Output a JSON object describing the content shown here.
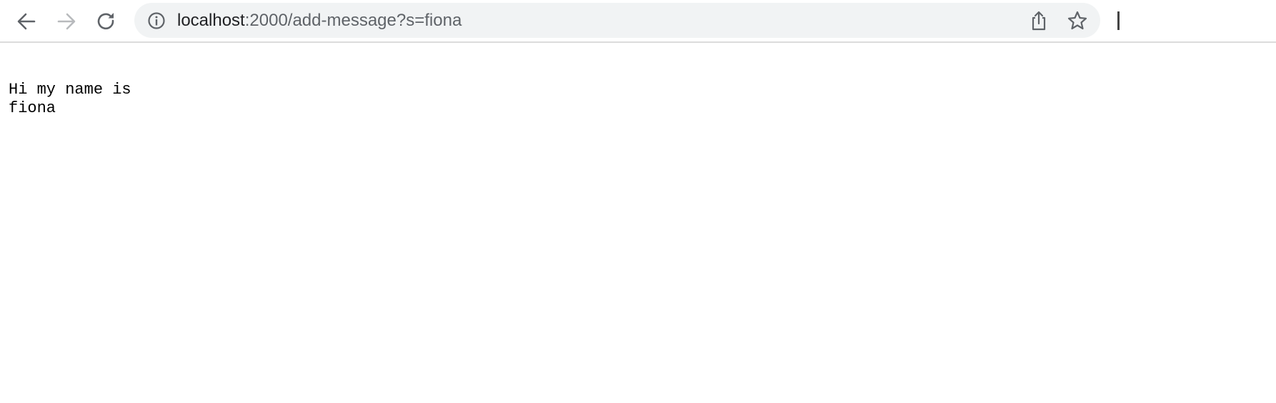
{
  "browser": {
    "url": {
      "host": "localhost",
      "rest": ":2000/add-message?s=fiona"
    },
    "icons": {
      "back": "arrow-left-icon",
      "forward": "arrow-right-icon",
      "reload": "reload-icon",
      "info": "info-icon",
      "share": "share-icon",
      "bookmark": "star-icon"
    },
    "colors": {
      "omnibox_bg": "#f1f3f4",
      "icon_active": "#5f6368",
      "icon_disabled": "#b8babd"
    }
  },
  "page": {
    "lines": [
      "Hi my name is",
      "fiona"
    ]
  }
}
